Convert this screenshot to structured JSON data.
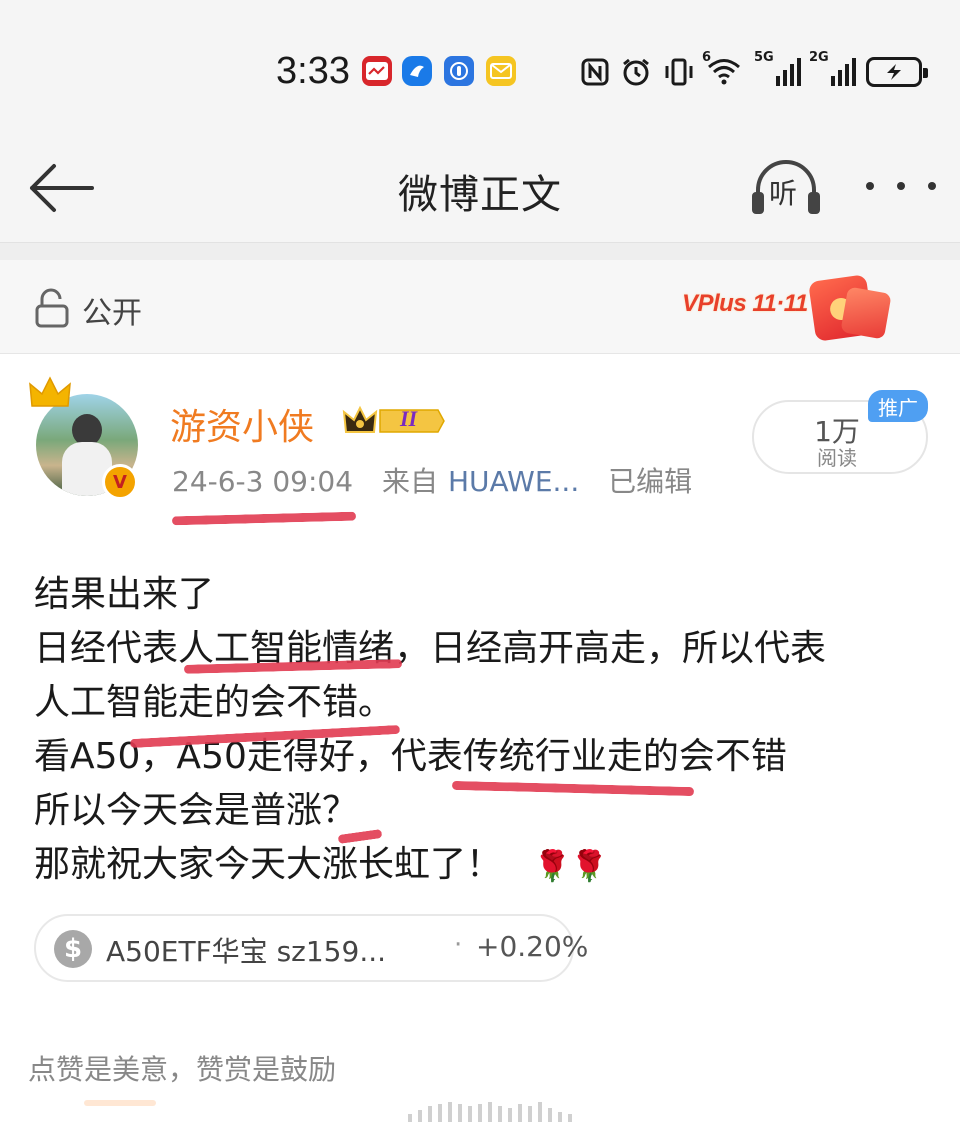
{
  "status_bar": {
    "time": "3:33",
    "network_5g": "5G",
    "network_2g": "2G",
    "network_6": "6"
  },
  "nav": {
    "title": "微博正文",
    "listen_label": "听"
  },
  "visibility": {
    "label": "公开",
    "banner_text": "VPlus 11·11"
  },
  "author": {
    "name": "游资小侠",
    "member_level": "II",
    "vip_mark": "V",
    "timestamp": "24-6-3 09:04",
    "source_prefix": "来自",
    "source": "HUAWE...",
    "edited": "已编辑"
  },
  "stats": {
    "read_count": "1万",
    "read_label": "阅读",
    "promo_tag": "推广"
  },
  "post": {
    "lines": [
      "结果出来了",
      "日经代表人工智能情绪，日经高开高走，所以代表",
      "人工智能走的会不错。",
      "看A50，A50走得好，代表传统行业走的会不错",
      "所以今天会是普涨？",
      "那就祝大家今天大涨长虹了！"
    ],
    "emoji": "🌹🌹"
  },
  "stock": {
    "name": "A50ETF华宝 sz159...",
    "separator": "·",
    "change": "+0.20%",
    "icon": "dollar-icon"
  },
  "footer": {
    "reward_note": "点赞是美意，赞赏是鼓励"
  },
  "colors": {
    "username": "#f07b21",
    "annotation": "#e23b52",
    "promo": "#4f9ff2",
    "source_link": "#5b7aa8"
  }
}
